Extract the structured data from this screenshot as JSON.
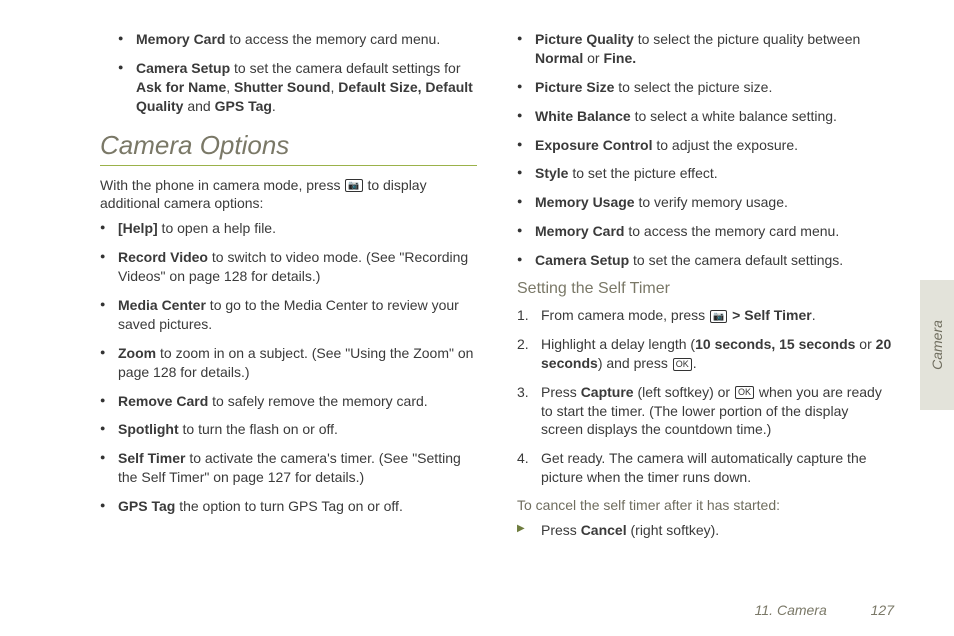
{
  "left": {
    "pre_bullets": [
      [
        {
          "b": true,
          "t": "Memory Card"
        },
        {
          "t": " to access the memory card menu."
        }
      ],
      [
        {
          "b": true,
          "t": "Camera Setup"
        },
        {
          "t": " to set the camera default settings for "
        },
        {
          "b": true,
          "t": "Ask for Name"
        },
        {
          "t": ", "
        },
        {
          "b": true,
          "t": "Shutter Sound"
        },
        {
          "t": ", "
        },
        {
          "b": true,
          "t": "Default Size, Default Quality"
        },
        {
          "t": " and "
        },
        {
          "b": true,
          "t": "GPS Tag"
        },
        {
          "t": "."
        }
      ]
    ],
    "section_title": "Camera Options",
    "intro_pre": "With the phone in camera mode, press ",
    "intro_post": " to display additional camera options:",
    "options": [
      [
        {
          "b": true,
          "t": "[Help]"
        },
        {
          "t": " to open a help file."
        }
      ],
      [
        {
          "b": true,
          "t": "Record Video"
        },
        {
          "t": " to switch to video mode. (See \"Recording Videos\" on page 128 for details.)"
        }
      ],
      [
        {
          "b": true,
          "t": "Media Center"
        },
        {
          "t": " to go to the Media Center to review your saved pictures."
        }
      ],
      [
        {
          "b": true,
          "t": "Zoom"
        },
        {
          "t": " to zoom in on a subject. (See \"Using the Zoom\" on page 128 for details.)"
        }
      ],
      [
        {
          "b": true,
          "t": "Remove Card"
        },
        {
          "t": " to safely remove the memory card."
        }
      ],
      [
        {
          "b": true,
          "t": "Spotlight"
        },
        {
          "t": " to turn the flash on or off."
        }
      ],
      [
        {
          "b": true,
          "t": "Self Timer"
        },
        {
          "t": " to activate the camera's timer. (See \"Setting the Self Timer\" on page 127 for details.)"
        }
      ],
      [
        {
          "b": true,
          "t": "GPS Tag"
        },
        {
          "t": " the option to turn GPS Tag on or off."
        }
      ]
    ]
  },
  "right": {
    "options": [
      [
        {
          "b": true,
          "t": "Picture Quality"
        },
        {
          "t": " to select the picture quality between "
        },
        {
          "b": true,
          "t": "Normal"
        },
        {
          "t": " or "
        },
        {
          "b": true,
          "t": "Fine."
        }
      ],
      [
        {
          "b": true,
          "t": "Picture Size"
        },
        {
          "t": " to select the picture size."
        }
      ],
      [
        {
          "b": true,
          "t": "White Balance"
        },
        {
          "t": " to select a white balance setting."
        }
      ],
      [
        {
          "b": true,
          "t": "Exposure Control"
        },
        {
          "t": " to adjust the exposure."
        }
      ],
      [
        {
          "b": true,
          "t": "Style"
        },
        {
          "t": " to set the picture effect."
        }
      ],
      [
        {
          "b": true,
          "t": "Memory Usage"
        },
        {
          "t": " to verify memory usage."
        }
      ],
      [
        {
          "b": true,
          "t": "Memory Card"
        },
        {
          "t": " to access the memory card menu."
        }
      ],
      [
        {
          "b": true,
          "t": "Camera Setup"
        },
        {
          "t": " to set the camera default settings."
        }
      ]
    ],
    "sub_title": "Setting the Self Timer",
    "steps": [
      [
        {
          "t": "From camera mode, press "
        },
        {
          "icon": "camera"
        },
        {
          "t": " "
        },
        {
          "b": true,
          "t": "> Self Timer"
        },
        {
          "t": "."
        }
      ],
      [
        {
          "t": "Highlight a delay length ("
        },
        {
          "b": true,
          "t": "10 seconds, 15 seconds"
        },
        {
          "t": " or "
        },
        {
          "b": true,
          "t": "20 seconds"
        },
        {
          "t": ") and press "
        },
        {
          "icon": "ok"
        },
        {
          "t": "."
        }
      ],
      [
        {
          "t": "Press "
        },
        {
          "b": true,
          "t": "Capture"
        },
        {
          "t": " (left softkey) or "
        },
        {
          "icon": "ok"
        },
        {
          "t": " when you are ready to start the timer. (The lower portion of the display screen displays the countdown time.)"
        }
      ],
      [
        {
          "t": "Get ready. The camera will automatically capture the picture when the timer runs down."
        }
      ]
    ],
    "cancel_lead": "To cancel the self timer after it has started:",
    "cancel": [
      [
        {
          "t": "Press "
        },
        {
          "b": true,
          "t": "Cancel"
        },
        {
          "t": " (right softkey)."
        }
      ]
    ]
  },
  "footer": {
    "chapter": "11. Camera",
    "page": "127"
  },
  "side_tab": "Camera",
  "icons": {
    "camera": "📷",
    "ok": "OK"
  }
}
